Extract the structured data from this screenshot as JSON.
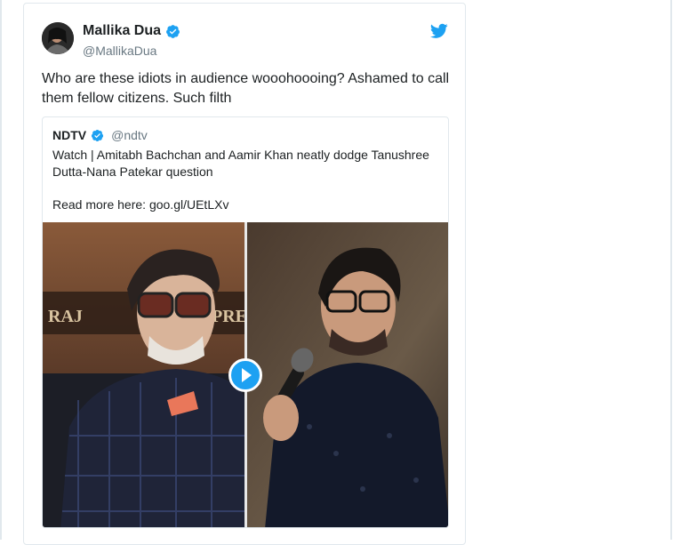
{
  "tweet": {
    "author_name": "Mallika Dua",
    "author_handle": "@MallikaDua",
    "text": "Who are these idiots in audience wooohoooing? Ashamed to call them fellow citizens. Such filth"
  },
  "quote": {
    "author_name": "NDTV",
    "author_handle": "@ndtv",
    "text": "Watch | Amitabh Bachchan and Aamir Khan neatly dodge Tanushree Dutta-Nana Patekar question",
    "link_text": "Read more here: goo.gl/UEtLXv",
    "poster_text_left": "RAJ",
    "poster_text_right": "PRESE"
  },
  "colors": {
    "twitter_blue": "#1da1f2",
    "verified_blue": "#1da1f2",
    "text_primary": "#1c2022",
    "text_secondary": "#697882",
    "border": "#e1e8ed"
  },
  "icons": {
    "brand": "twitter-bird-icon",
    "verified": "verified-badge-icon",
    "media_action": "play-icon"
  }
}
